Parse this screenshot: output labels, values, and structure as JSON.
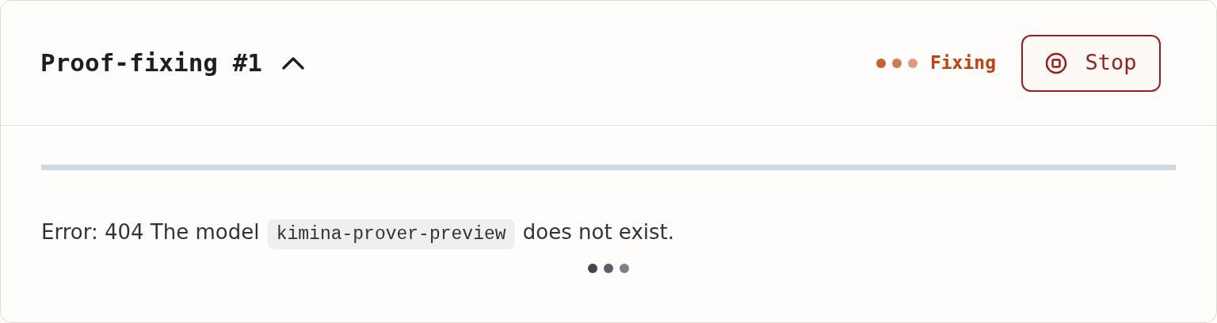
{
  "panel": {
    "title": "Proof-fixing #1",
    "expanded": true
  },
  "status": {
    "label": "Fixing"
  },
  "stop_button": {
    "label": "Stop"
  },
  "message": {
    "prefix": "Error: 404 The model",
    "code": "kimina-prover-preview",
    "suffix": "does not exist."
  }
}
